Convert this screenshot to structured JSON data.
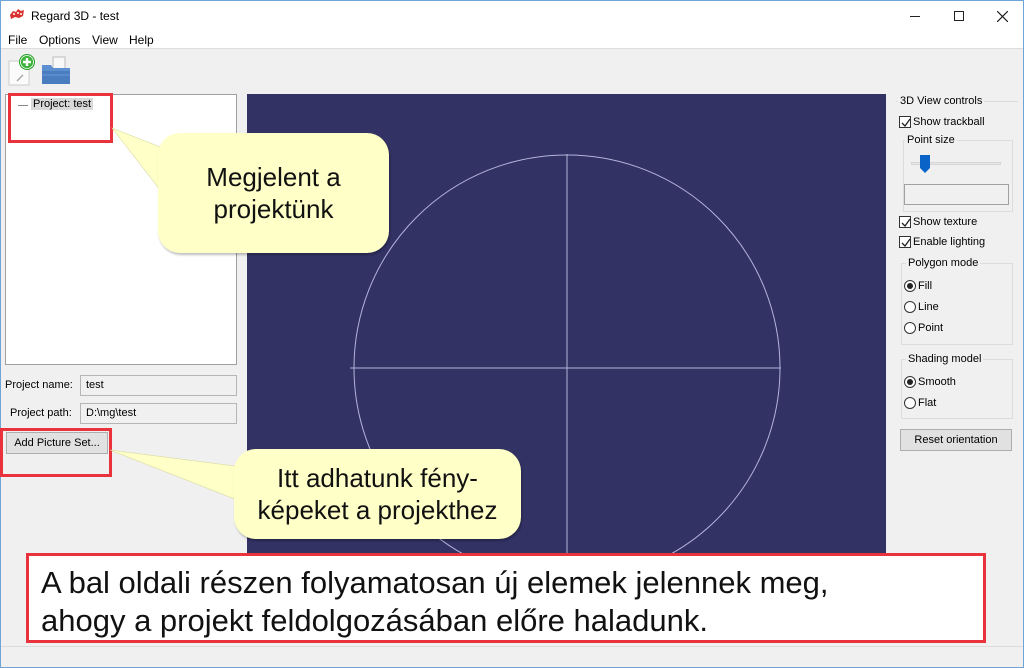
{
  "window": {
    "title": "Regard 3D - test",
    "controls": {
      "minimize": "–",
      "maximize": "☐",
      "close": "✕"
    }
  },
  "menu": [
    "File",
    "Options",
    "View",
    "Help"
  ],
  "toolbar": {
    "buttons": [
      {
        "name": "new-project",
        "icon": "new-project-icon"
      },
      {
        "name": "open-project",
        "icon": "open-folder-icon"
      }
    ]
  },
  "project_tree": {
    "items": [
      {
        "label": "Project: test"
      }
    ]
  },
  "project_form": {
    "name_label": "Project name:",
    "name_value": "test",
    "path_label": "Project path:",
    "path_value": "D:\\mg\\test",
    "add_picture_set_label": "Add Picture Set..."
  },
  "view_controls": {
    "title": "3D View controls",
    "show_trackball": {
      "label": "Show trackball",
      "checked": true
    },
    "point_size": {
      "title": "Point size",
      "value": 0.15,
      "field_value": ""
    },
    "show_texture": {
      "label": "Show texture",
      "checked": true
    },
    "enable_lighting": {
      "label": "Enable lighting",
      "checked": true
    },
    "polygon_mode": {
      "title": "Polygon mode",
      "options": [
        "Fill",
        "Line",
        "Point"
      ],
      "selected": "Fill"
    },
    "shading_model": {
      "title": "Shading model",
      "options": [
        "Smooth",
        "Flat"
      ],
      "selected": "Smooth"
    },
    "reset_orientation_label": "Reset orientation"
  },
  "colors": {
    "viewport_bg": "#323264",
    "trackball": "#b4b4dc",
    "highlight": "#e8323c",
    "callout_bg": "#ffffc8"
  },
  "annotations": {
    "callout_project": "Megjelent a projektünk",
    "callout_project_lines": [
      "Megjelent a",
      "projektünk"
    ],
    "callout_pictures_lines": [
      "Itt adhatunk fény-",
      "képeket a projekthez"
    ],
    "note_lines": [
      "A bal oldali részen folyamatosan új elemek jelennek meg,",
      "ahogy a projekt feldolgozásában előre haladunk."
    ]
  }
}
